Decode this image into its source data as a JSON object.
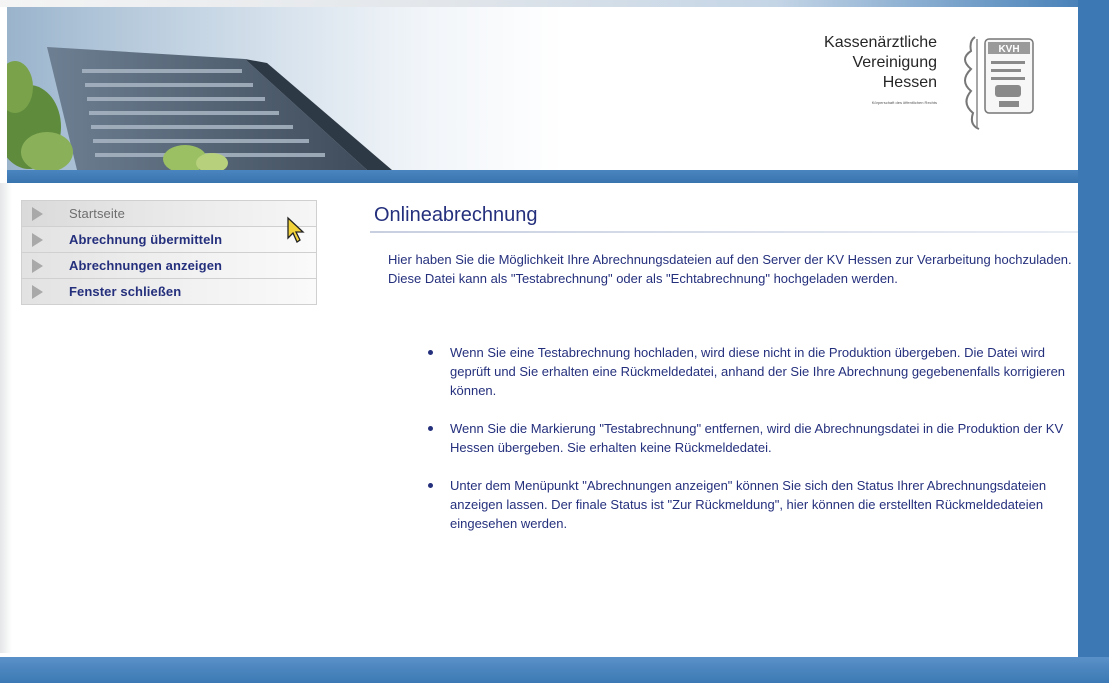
{
  "logo": {
    "lines": [
      "Kassenärztliche",
      "Vereinigung",
      "Hessen"
    ],
    "subtitle": "Körperschaft des öffentlichen Rechts",
    "crest_text": "KVH"
  },
  "menu": {
    "items": [
      {
        "label": "Startseite",
        "active": true
      },
      {
        "label": "Abrechnung übermitteln",
        "active": false
      },
      {
        "label": "Abrechnungen anzeigen",
        "active": false
      },
      {
        "label": "Fenster schließen",
        "active": false
      }
    ]
  },
  "content": {
    "title": "Onlineabrechnung",
    "intro": "Hier haben Sie die Möglichkeit Ihre Abrechnungsdateien auf den Server der KV Hessen zur Verarbeitung hochzuladen. Diese Datei kann als \"Testabrechnung\" oder als \"Echtabrechnung\" hochgeladen werden.",
    "bullets": [
      "Wenn Sie eine Testabrechnung hochladen, wird diese nicht in die Produktion übergeben. Die Datei wird geprüft und Sie erhalten eine Rückmeldedatei, anhand der Sie Ihre Abrechnung gegebenenfalls korrigieren können.",
      "Wenn Sie die Markierung \"Testabrechnung\" entfernen, wird die Abrechnungsdatei in die Produktion der KV Hessen übergeben. Sie erhalten keine Rückmeldedatei.",
      "Unter dem Menüpunkt \"Abrechnungen anzeigen\" können Sie sich den Status Ihrer Abrechnungsdateien anzeigen lassen. Der finale Status ist \"Zur Rückmeldung\", hier können die erstellten Rückmeldedateien eingesehen werden."
    ]
  },
  "colors": {
    "brand_blue": "#3c79b4",
    "text_navy": "#25307d",
    "menu_arrow": "#a9a9a9"
  }
}
